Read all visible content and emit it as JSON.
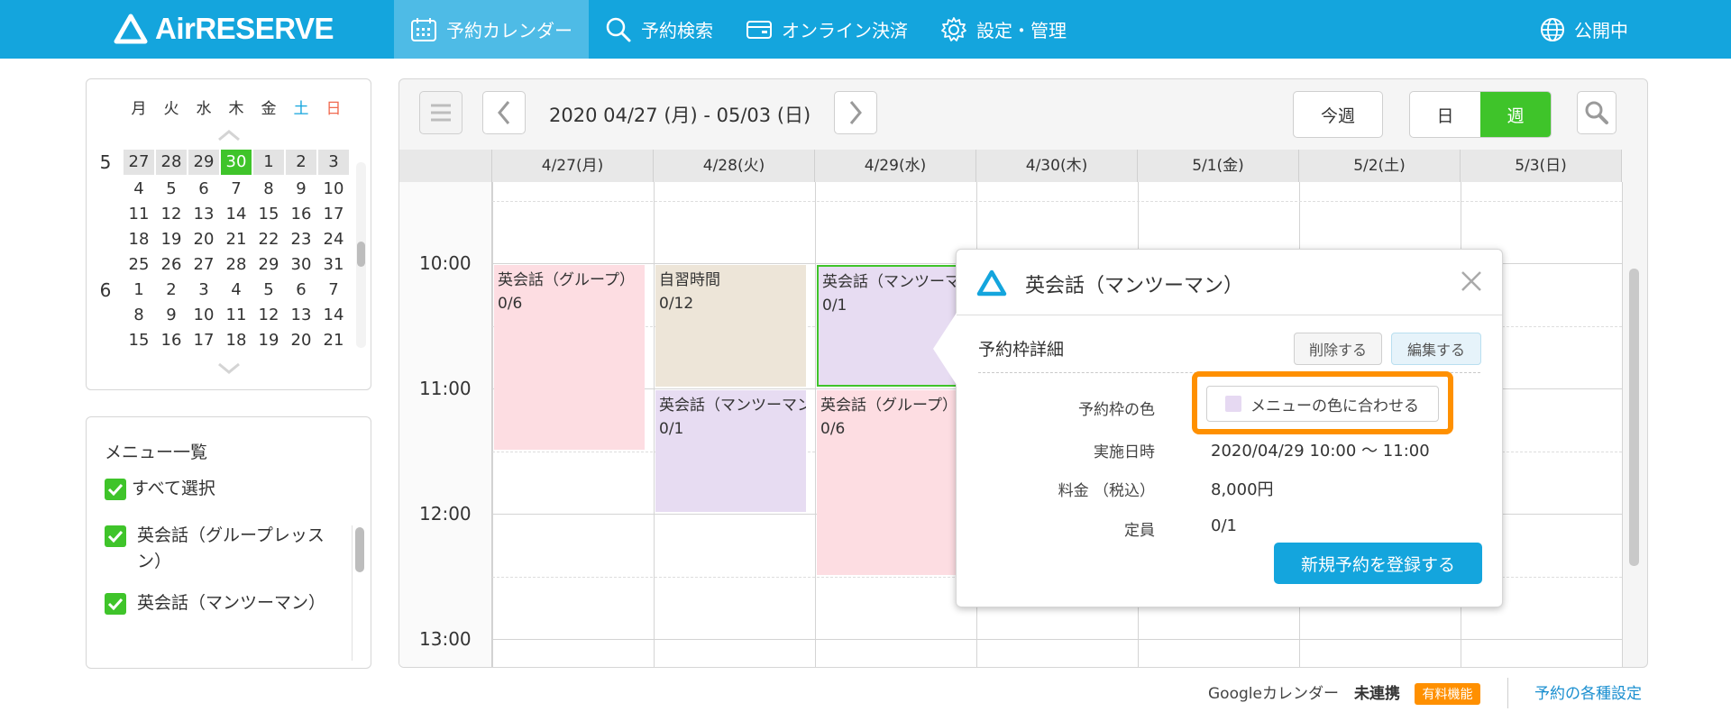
{
  "app": {
    "logo_text": "AirRESERVE"
  },
  "nav": [
    {
      "label": "予約カレンダー",
      "icon": "calendar-icon",
      "active": true
    },
    {
      "label": "予約検索",
      "icon": "search-icon"
    },
    {
      "label": "オンライン決済",
      "icon": "wallet-icon"
    },
    {
      "label": "設定・管理",
      "icon": "gear-icon"
    }
  ],
  "status": {
    "label": "公開中",
    "icon": "globe-icon"
  },
  "minical": {
    "weekdays": [
      "月",
      "火",
      "水",
      "木",
      "金",
      "土",
      "日"
    ],
    "weekday_colors": {
      "sat": "#14a5dd",
      "sun": "#f06a50"
    },
    "rows": [
      {
        "month": "5",
        "days": [
          "27",
          "28",
          "29",
          "30",
          "1",
          "2",
          "3"
        ]
      },
      {
        "month": "",
        "days": [
          "4",
          "5",
          "6",
          "7",
          "8",
          "9",
          "10"
        ]
      },
      {
        "month": "",
        "days": [
          "11",
          "12",
          "13",
          "14",
          "15",
          "16",
          "17"
        ]
      },
      {
        "month": "",
        "days": [
          "18",
          "19",
          "20",
          "21",
          "22",
          "23",
          "24"
        ]
      },
      {
        "month": "",
        "days": [
          "25",
          "26",
          "27",
          "28",
          "29",
          "30",
          "31"
        ]
      },
      {
        "month": "6",
        "days": [
          "1",
          "2",
          "3",
          "4",
          "5",
          "6",
          "7"
        ]
      },
      {
        "month": "",
        "days": [
          "8",
          "9",
          "10",
          "11",
          "12",
          "13",
          "14"
        ]
      },
      {
        "month": "",
        "days": [
          "15",
          "16",
          "17",
          "18",
          "19",
          "20",
          "21"
        ]
      }
    ],
    "today": "30"
  },
  "menu_list": {
    "title": "メニュー一覧",
    "select_all": "すべて選択",
    "items": [
      "英会話（グループレッスン）",
      "英会話（マンツーマン）"
    ]
  },
  "calendar": {
    "date_range": "2020 04/27 (月) - 05/03 (日)",
    "this_week": "今週",
    "view_day": "日",
    "view_week": "週",
    "days": [
      "4/27(月)",
      "4/28(火)",
      "4/29(水)",
      "4/30(木)",
      "5/1(金)",
      "5/2(土)",
      "5/3(日)"
    ],
    "times": [
      "10:00",
      "11:00",
      "12:00",
      "13:00"
    ],
    "events": [
      {
        "title": "英会話（グループ）",
        "count": "0/6",
        "day": 0,
        "start": 10.0,
        "end": 11.5,
        "color": "#fddde2"
      },
      {
        "title": "自習時間",
        "count": "0/12",
        "day": 1,
        "start": 10.0,
        "end": 11.0,
        "color": "#ede5d8"
      },
      {
        "title": "英会話（マンツーマン）",
        "count": "0/1",
        "day": 1,
        "start": 11.0,
        "end": 12.0,
        "color": "#e7dcf2"
      },
      {
        "title": "英会話（マンツーマン）",
        "count": "0/1",
        "day": 2,
        "start": 10.0,
        "end": 11.0,
        "color": "#e7dcf2",
        "selected": true
      },
      {
        "title": "英会話（グループ）",
        "count": "0/6",
        "day": 2,
        "start": 11.0,
        "end": 12.5,
        "color": "#fddde2"
      }
    ]
  },
  "popup": {
    "title": "英会話（マンツーマン）",
    "section": "予約枠詳細",
    "delete_label": "削除する",
    "edit_label": "編集する",
    "color_label": "予約枠の色",
    "color_value": "メニューの色に合わせる",
    "date_label": "実施日時",
    "date_value": "2020/04/29 10:00 〜 11:00",
    "price_label": "料金 （税込）",
    "price_value": "8,000円",
    "capacity_label": "定員",
    "capacity_value": "0/1",
    "new_booking_label": "新規予約を登録する"
  },
  "footer": {
    "google_label": "Googleカレンダー",
    "google_status": "未連携",
    "badge": "有料機能",
    "settings_link": "予約の各種設定"
  }
}
